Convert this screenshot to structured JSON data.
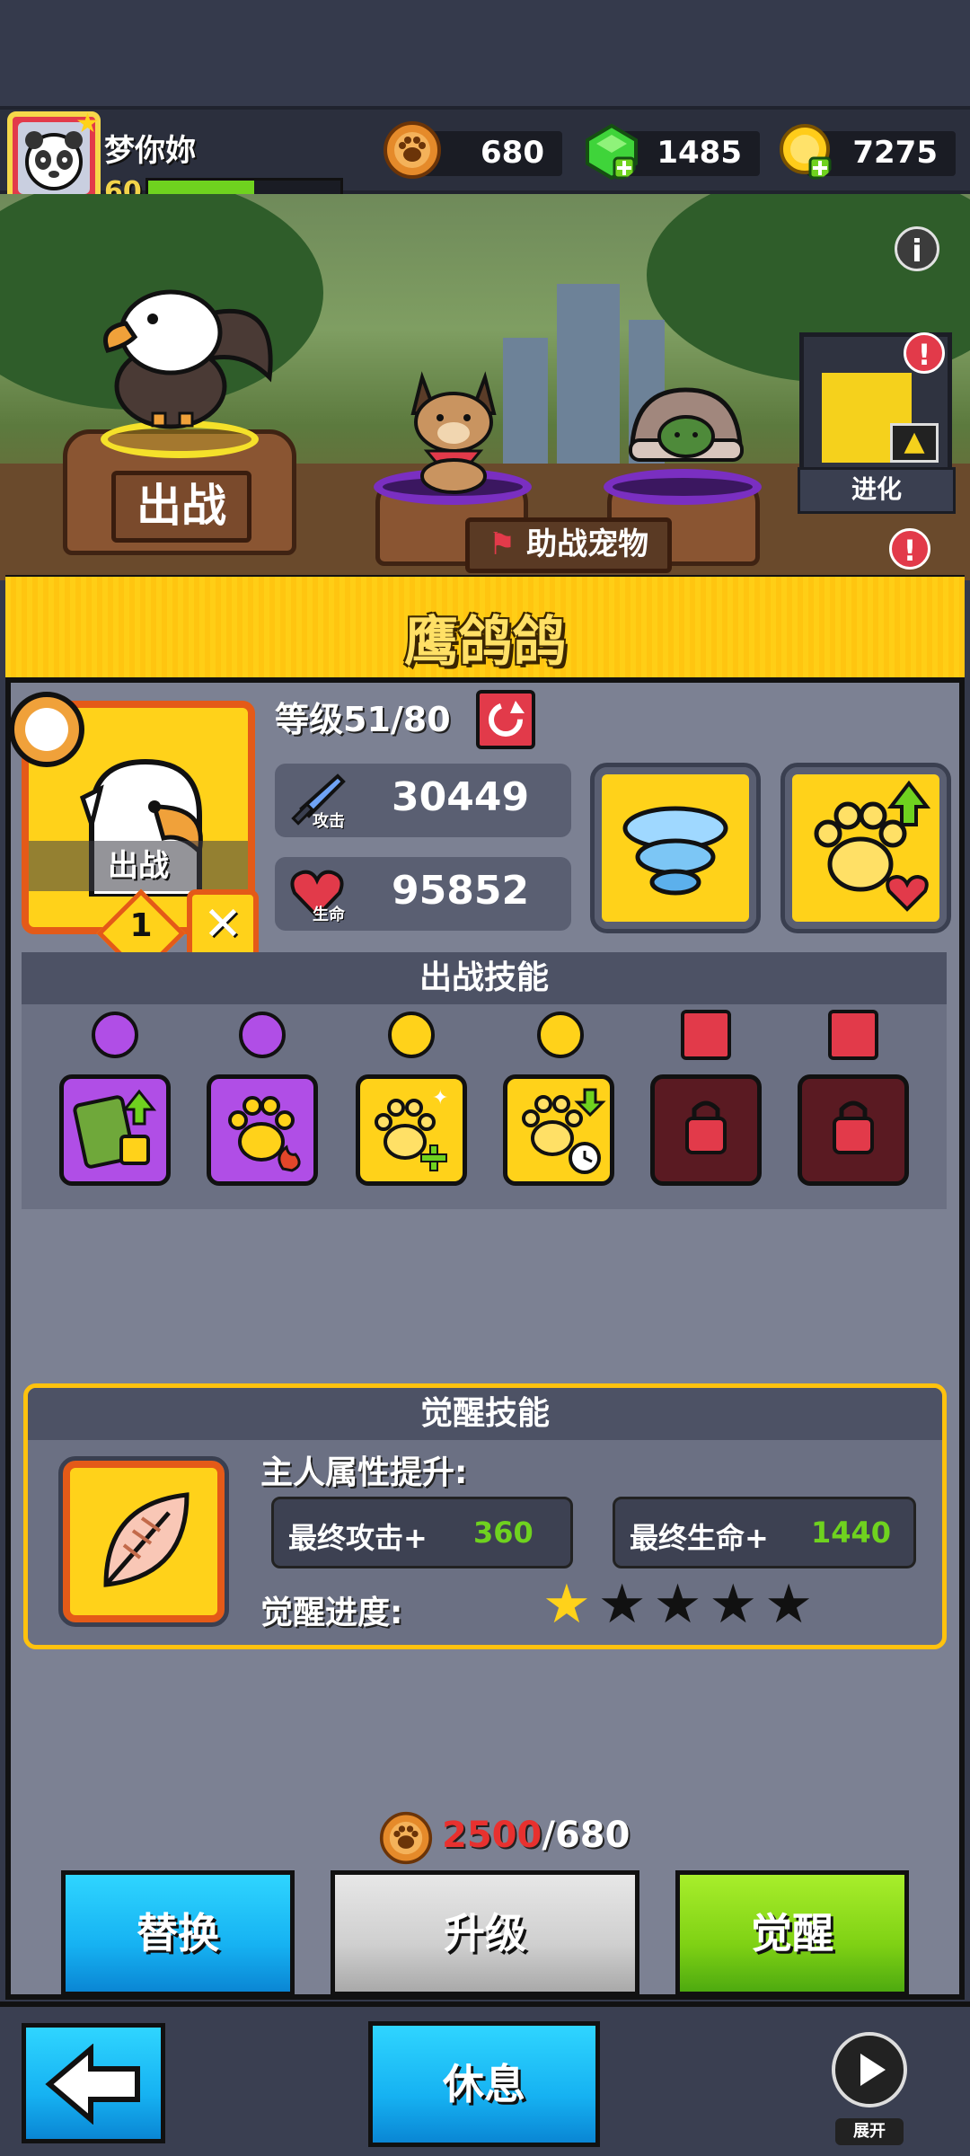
{
  "player": {
    "name": "梦你妳",
    "level": "60",
    "xp_fraction": 0.55
  },
  "currencies": [
    {
      "icon": "paw-coin-icon",
      "value": "680"
    },
    {
      "icon": "green-gem-icon",
      "value": "1485"
    },
    {
      "icon": "gold-coin-icon",
      "value": "7275"
    }
  ],
  "scene": {
    "deploy_label": "出战",
    "assist_label": "助战宠物",
    "evolve_label": "进化",
    "info_glyph": "i",
    "alert_glyph": "!"
  },
  "pet": {
    "name": "鹰鸽鸽",
    "card_label": "出战",
    "level_text": "等级51/80",
    "slot_number": "1",
    "attack_label": "攻击",
    "attack": "30449",
    "hp_label": "生命",
    "hp": "95852"
  },
  "battle_skills": {
    "title": "出战技能",
    "slots": [
      {
        "icon": "card-upgrade-icon",
        "color": "purple",
        "badge": "rotate-icon"
      },
      {
        "icon": "paw-fire-icon",
        "color": "purple",
        "badge": "rotate-icon"
      },
      {
        "icon": "paw-plus-icon",
        "color": "yellow",
        "badge": "rotate-icon"
      },
      {
        "icon": "paw-clock-icon",
        "color": "yellow",
        "badge": "rotate-icon"
      },
      {
        "icon": "locked-skill-icon",
        "color": "dark",
        "badge": "lock-icon"
      },
      {
        "icon": "locked-skill-icon",
        "color": "dark",
        "badge": "lock-icon"
      }
    ]
  },
  "awaken": {
    "title": "觉醒技能",
    "owner_boost_label": "主人属性提升:",
    "final_attack_label": "最终攻击+",
    "final_attack_value": "360",
    "final_hp_label": "最终生命+",
    "final_hp_value": "1440",
    "progress_label": "觉醒进度:",
    "stars_filled": 1,
    "stars_total": 5
  },
  "cost": {
    "required": "2500",
    "separator": "/",
    "owned": "680"
  },
  "buttons": {
    "replace": "替换",
    "upgrade": "升级",
    "awaken": "觉醒",
    "rest": "休息"
  },
  "expand_label": "展开",
  "colors": {
    "accent_yellow": "#ffd21a",
    "alert_red": "#e23a4a",
    "green": "#6fd21f",
    "blue": "#16b2f2"
  }
}
